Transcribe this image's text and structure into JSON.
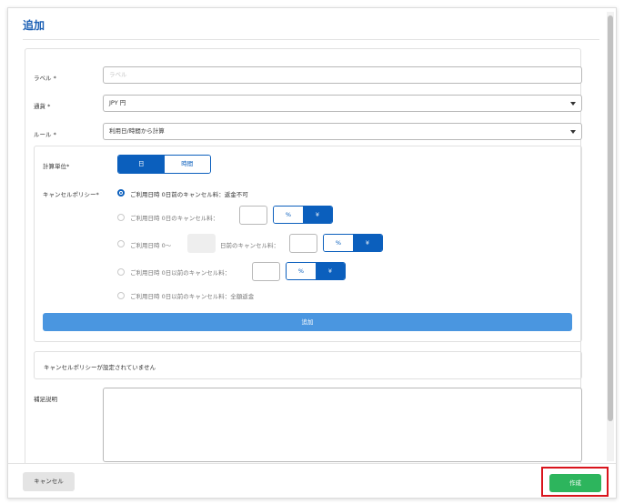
{
  "modal": {
    "title": "追加"
  },
  "form": {
    "label": {
      "label": "ラベル *",
      "placeholder": "ラベル"
    },
    "currency": {
      "label": "通貨 *",
      "value": "JPY 円"
    },
    "rule": {
      "label": "ルール *",
      "value": "利用日/時間から計算"
    },
    "description": {
      "label": "補足説明"
    }
  },
  "policy": {
    "unit_label": "計算単位*",
    "unit_options": [
      "日",
      "時間"
    ],
    "unit_selected": "日",
    "policy_label": "キャンセルポリシー*",
    "options": [
      {
        "text": "ご利用日時 0日前のキャンセル料：返金不可",
        "checked": true
      },
      {
        "text": "ご利用日時 0日のキャンセル料：",
        "checked": false
      },
      {
        "text_before": "ご利用日時 0〜",
        "text_after": "日前のキャンセル料：",
        "checked": false
      },
      {
        "text": "ご利用日時 0日以前のキャンセル料：",
        "checked": false
      },
      {
        "text": "ご利用日時 0日以前のキャンセル料：全額返金",
        "checked": false
      }
    ],
    "toggle_percent": "%",
    "toggle_yen": "¥",
    "add_button": "追加"
  },
  "notice": {
    "text": "キャンセルポリシーが設定されていません"
  },
  "footer": {
    "cancel_label": "キャンセル",
    "create_label": "作成"
  },
  "colors": {
    "primary": "#0b5fbd",
    "add_button": "#4a96e0",
    "create_button": "#2db55d",
    "highlight_frame": "#d9141c"
  }
}
